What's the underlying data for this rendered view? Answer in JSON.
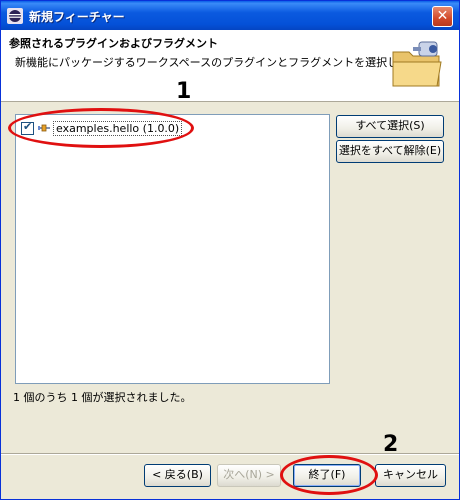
{
  "window": {
    "title": "新規フィーチャー",
    "close_glyph": "✕"
  },
  "header": {
    "title": "参照されるプラグインおよびフラグメント",
    "subtitle": "新機能にパッケージするワークスペースのプラグインとフラグメントを選択します。"
  },
  "plugin_list": {
    "items": [
      {
        "label": "examples.hello (1.0.0)",
        "checked": true
      }
    ]
  },
  "side_buttons": {
    "select_all": "すべて選択(S)",
    "deselect_all": "選択をすべて解除(E)"
  },
  "status": "1 個のうち 1 個が選択されました。",
  "footer": {
    "back": "< 戻る(B)",
    "next": "次へ(N) >",
    "finish": "終了(F)",
    "cancel": "キャンセル"
  },
  "annotations": {
    "callout_1": "1",
    "callout_2": "2",
    "color": "#e01010"
  }
}
